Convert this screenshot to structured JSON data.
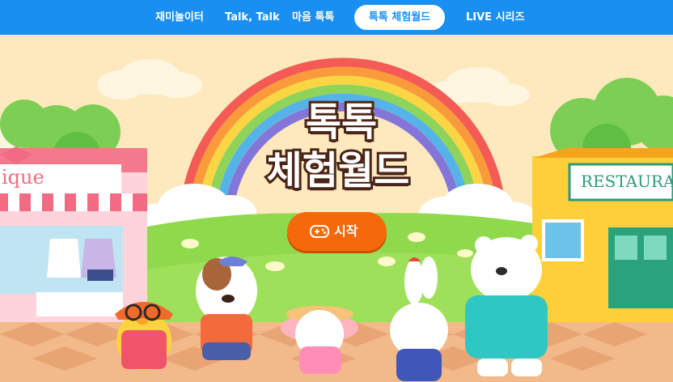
{
  "nav": {
    "items": [
      {
        "label": "재미놀이터"
      },
      {
        "label": "Talk, Talk"
      },
      {
        "label": "마음 톡톡"
      },
      {
        "label": "톡톡 체험월드"
      },
      {
        "label": "LIVE 시리즈"
      }
    ],
    "active_index": 3
  },
  "hero": {
    "title_line1": "톡톡",
    "title_line2": "체험월드",
    "start_label": "시작",
    "start_icon": "gamepad-icon"
  },
  "shops": {
    "left_sign": "ique",
    "right_sign": "RESTAURA"
  },
  "colors": {
    "nav_bg": "#1a8ff2",
    "start_button": "#f5690a",
    "title_stroke": "#4a2416"
  }
}
